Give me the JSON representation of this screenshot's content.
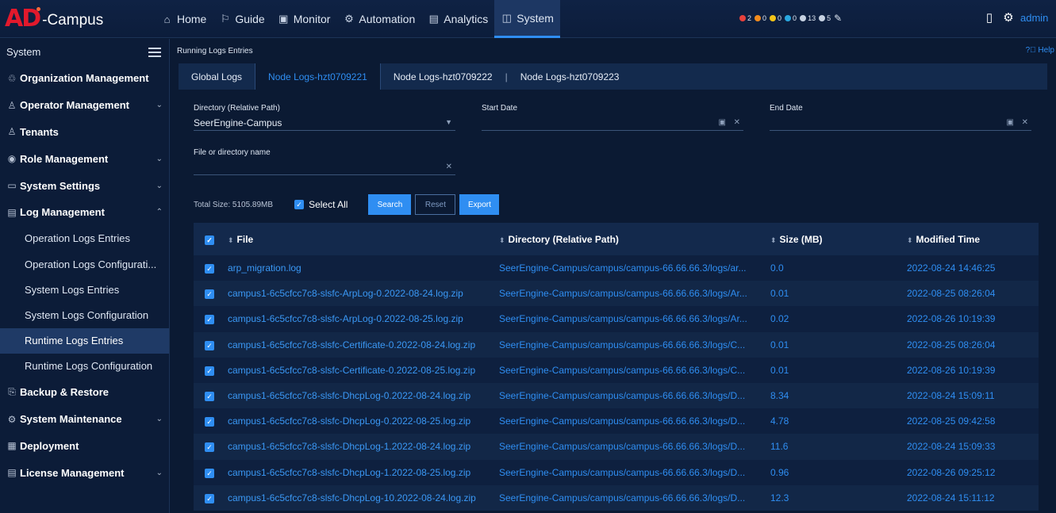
{
  "app": {
    "logo_mark": "AD",
    "logo_text": "-Campus"
  },
  "nav": [
    {
      "label": "Home",
      "icon": "home-icon",
      "glyph": "⌂"
    },
    {
      "label": "Guide",
      "icon": "guide-icon",
      "glyph": "⚐"
    },
    {
      "label": "Monitor",
      "icon": "monitor-icon",
      "glyph": "▣"
    },
    {
      "label": "Automation",
      "icon": "automation-icon",
      "glyph": "⚙"
    },
    {
      "label": "Analytics",
      "icon": "analytics-icon",
      "glyph": "▤"
    },
    {
      "label": "System",
      "icon": "system-icon",
      "glyph": "◫",
      "active": true
    }
  ],
  "alarms": [
    {
      "count": "2",
      "color": "#e8413c"
    },
    {
      "count": "0",
      "color": "#f28b1d"
    },
    {
      "count": "0",
      "color": "#f5c518"
    },
    {
      "count": "0",
      "color": "#2aa8e0"
    },
    {
      "count": "13",
      "color": "#c7d2e2"
    },
    {
      "count": "5",
      "color": "#c7d2e2"
    }
  ],
  "user": {
    "name": "admin"
  },
  "sidebar": {
    "title": "System",
    "items": [
      {
        "label": "Organization Management",
        "glyph": "♲",
        "chevron": ""
      },
      {
        "label": "Operator Management",
        "glyph": "♙",
        "chevron": "⌄"
      },
      {
        "label": "Tenants",
        "glyph": "♙",
        "chevron": ""
      },
      {
        "label": "Role Management",
        "glyph": "◉",
        "chevron": "⌄"
      },
      {
        "label": "System Settings",
        "glyph": "▭",
        "chevron": "⌄"
      },
      {
        "label": "Log Management",
        "glyph": "▤",
        "chevron": "⌃"
      }
    ],
    "log_sub": [
      "Operation Logs Entries",
      "Operation Logs Configurati...",
      "System Logs Entries",
      "System Logs Configuration",
      "Runtime Logs Entries",
      "Runtime Logs Configuration"
    ],
    "active_sub": 4,
    "items_after": [
      {
        "label": "Backup & Restore",
        "glyph": "⎘",
        "chevron": ""
      },
      {
        "label": "System Maintenance",
        "glyph": "⚙",
        "chevron": "⌄"
      },
      {
        "label": "Deployment",
        "glyph": "▦",
        "chevron": ""
      },
      {
        "label": "License Management",
        "glyph": "▤",
        "chevron": "⌄"
      }
    ]
  },
  "main": {
    "breadcrumb": "Running Logs Entries",
    "help": "Help",
    "tabs": [
      "Global Logs",
      "Node Logs-hzt0709221",
      "Node Logs-hzt0709222",
      "Node Logs-hzt0709223"
    ],
    "active_tab": 1,
    "tab_separator": "|",
    "filters": {
      "directory_label": "Directory (Relative Path)",
      "directory_value": "SeerEngine-Campus",
      "start_label": "Start Date",
      "start_value": "",
      "end_label": "End Date",
      "end_value": "",
      "name_label": "File or directory name",
      "name_value": ""
    },
    "total_size": "Total Size: 5105.89MB",
    "select_all": "Select All",
    "buttons": {
      "search": "Search",
      "reset": "Reset",
      "export": "Export"
    }
  },
  "table": {
    "columns": [
      "File",
      "Directory (Relative Path)",
      "Size (MB)",
      "Modified Time"
    ],
    "rows": [
      [
        "arp_migration.log",
        "SeerEngine-Campus/campus/campus-66.66.66.3/logs/ar...",
        "0.0",
        "2022-08-24 14:46:25"
      ],
      [
        "campus1-6c5cfcc7c8-slsfc-ArpLog-0.2022-08-24.log.zip",
        "SeerEngine-Campus/campus/campus-66.66.66.3/logs/Ar...",
        "0.01",
        "2022-08-25 08:26:04"
      ],
      [
        "campus1-6c5cfcc7c8-slsfc-ArpLog-0.2022-08-25.log.zip",
        "SeerEngine-Campus/campus/campus-66.66.66.3/logs/Ar...",
        "0.02",
        "2022-08-26 10:19:39"
      ],
      [
        "campus1-6c5cfcc7c8-slsfc-Certificate-0.2022-08-24.log.zip",
        "SeerEngine-Campus/campus/campus-66.66.66.3/logs/C...",
        "0.01",
        "2022-08-25 08:26:04"
      ],
      [
        "campus1-6c5cfcc7c8-slsfc-Certificate-0.2022-08-25.log.zip",
        "SeerEngine-Campus/campus/campus-66.66.66.3/logs/C...",
        "0.01",
        "2022-08-26 10:19:39"
      ],
      [
        "campus1-6c5cfcc7c8-slsfc-DhcpLog-0.2022-08-24.log.zip",
        "SeerEngine-Campus/campus/campus-66.66.66.3/logs/D...",
        "8.34",
        "2022-08-24 15:09:11"
      ],
      [
        "campus1-6c5cfcc7c8-slsfc-DhcpLog-0.2022-08-25.log.zip",
        "SeerEngine-Campus/campus/campus-66.66.66.3/logs/D...",
        "4.78",
        "2022-08-25 09:42:58"
      ],
      [
        "campus1-6c5cfcc7c8-slsfc-DhcpLog-1.2022-08-24.log.zip",
        "SeerEngine-Campus/campus/campus-66.66.66.3/logs/D...",
        "11.6",
        "2022-08-24 15:09:33"
      ],
      [
        "campus1-6c5cfcc7c8-slsfc-DhcpLog-1.2022-08-25.log.zip",
        "SeerEngine-Campus/campus/campus-66.66.66.3/logs/D...",
        "0.96",
        "2022-08-26 09:25:12"
      ],
      [
        "campus1-6c5cfcc7c8-slsfc-DhcpLog-10.2022-08-24.log.zip",
        "SeerEngine-Campus/campus/campus-66.66.66.3/logs/D...",
        "12.3",
        "2022-08-24 15:11:12"
      ]
    ]
  }
}
